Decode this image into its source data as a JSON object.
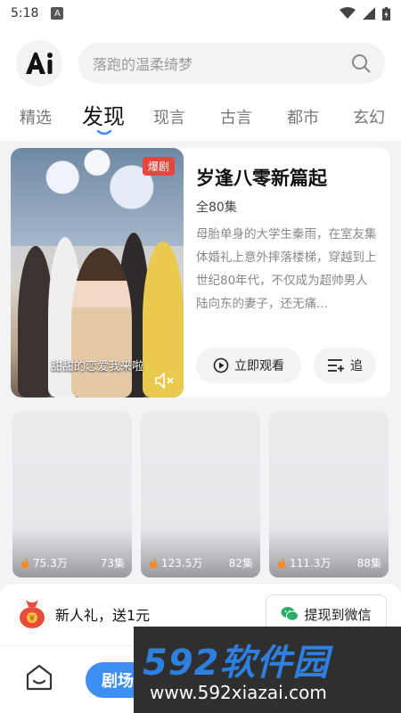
{
  "status_bar": {
    "time": "5:18",
    "notification_badge": "A"
  },
  "header": {
    "logo_text": "Ai",
    "search": {
      "placeholder": "落跑的温柔绮梦",
      "icon": "search-icon"
    },
    "tabs": [
      {
        "label": "精选",
        "active": false
      },
      {
        "label": "发现",
        "active": true
      },
      {
        "label": "现言",
        "active": false
      },
      {
        "label": "古言",
        "active": false
      },
      {
        "label": "都市",
        "active": false
      },
      {
        "label": "玄幻",
        "active": false
      }
    ]
  },
  "featured": {
    "badge": "爆剧",
    "subtitle": "甜甜的恋爱我来啦",
    "title": "岁逢八零新篇起",
    "episodes": "全80集",
    "description": "母胎单身的大学生秦雨，在室友集体婚礼上意外摔落楼梯，穿越到上世纪80年代，不仅成为超帅男人陆向东的妻子，还无痛...",
    "watch_label": "立即观看",
    "follow_label": "追"
  },
  "grid": [
    {
      "views": "75.3万",
      "episodes": "73集"
    },
    {
      "views": "123.5万",
      "episodes": "82集"
    },
    {
      "views": "111.3万",
      "episodes": "88集"
    }
  ],
  "promo": {
    "text": "新人礼，送1元",
    "button_label": "提现到微信"
  },
  "bottom_nav": {
    "pill_label": "剧场"
  },
  "watermark": {
    "brand": "592软件园",
    "url": "www.592xiazai.com"
  },
  "colors": {
    "accent": "#3d8ff5",
    "badge": "#e8453c",
    "wechat": "#2aae67",
    "flame": "#f28a1e"
  }
}
